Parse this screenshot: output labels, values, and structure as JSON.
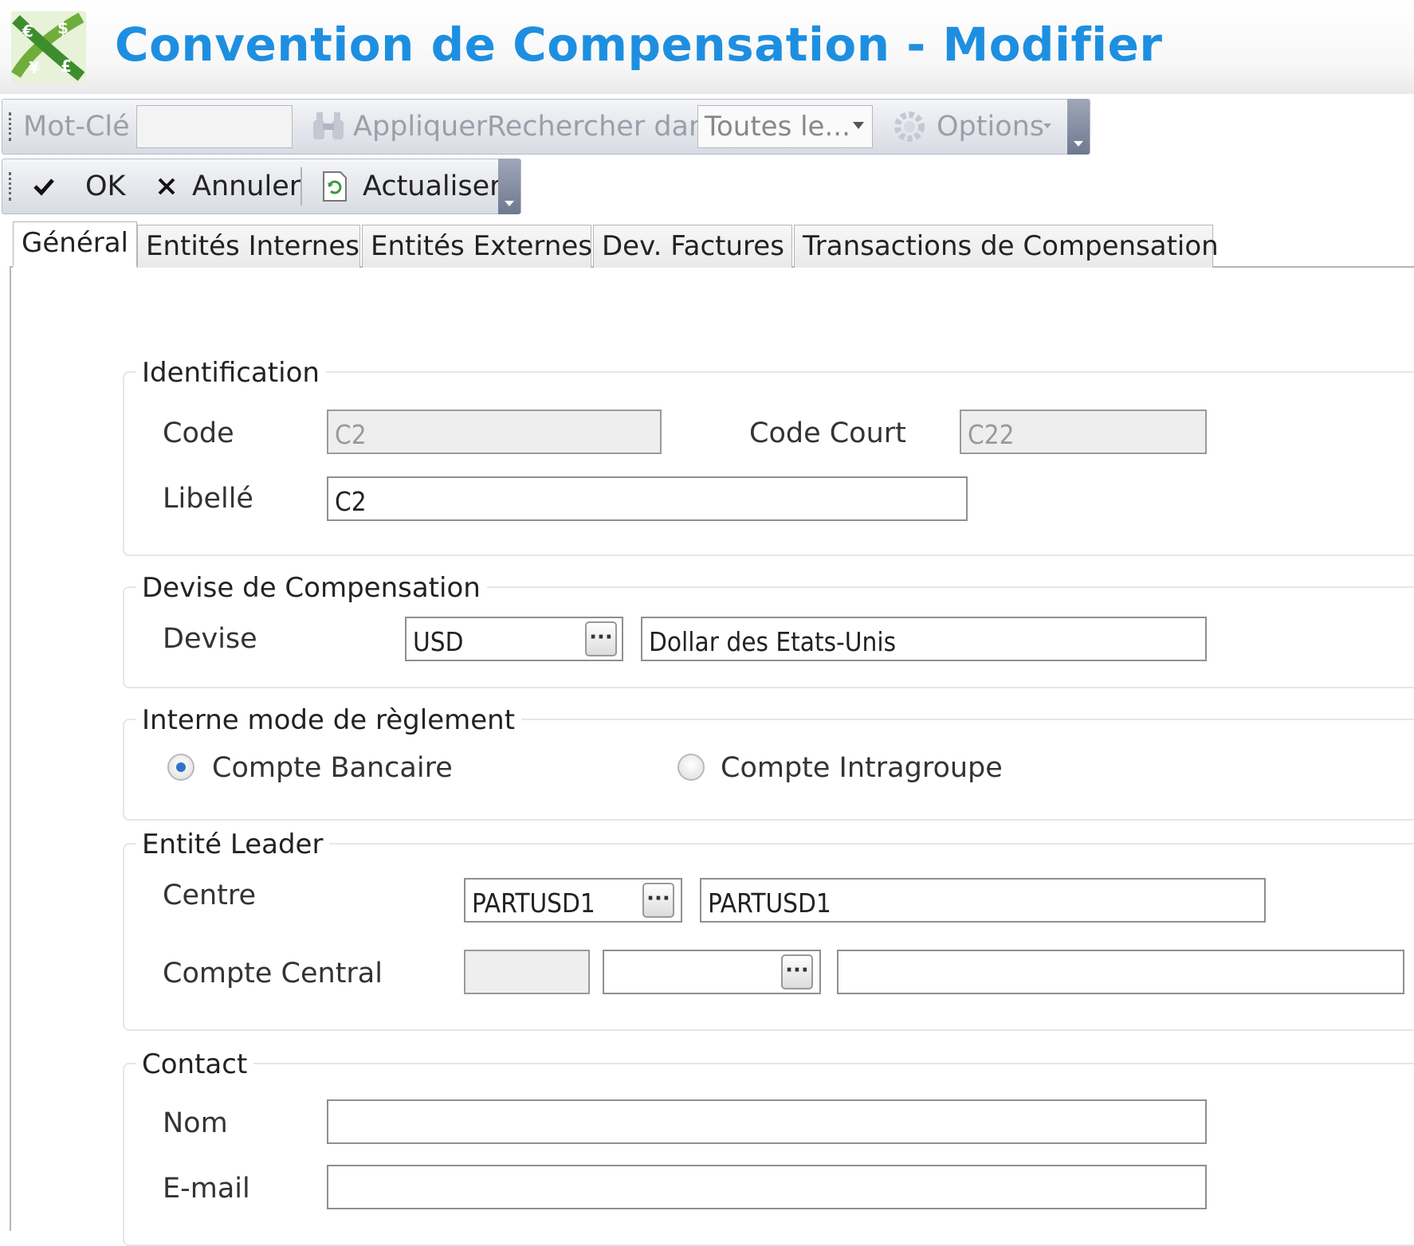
{
  "window": {
    "title": "Convention de Compensation - Modifier",
    "logo_icon": "currency-exchange-icon"
  },
  "search_toolbar": {
    "keyword_label": "Mot-Clé",
    "keyword_value": "",
    "apply_label": "Appliquer",
    "search_in_label": "Rechercher dans",
    "search_in_value": "Toutes le...",
    "options_label": "Options"
  },
  "action_toolbar": {
    "ok_label": "OK",
    "cancel_label": "Annuler",
    "refresh_label": "Actualiser"
  },
  "tabs": [
    {
      "label": "Général",
      "active": true
    },
    {
      "label": "Entités Internes"
    },
    {
      "label": "Entités Externes"
    },
    {
      "label": "Dev. Factures"
    },
    {
      "label": "Transactions de Compensation"
    }
  ],
  "identification": {
    "title": "Identification",
    "code_label": "Code",
    "code_value": "C2",
    "short_code_label": "Code Court",
    "short_code_value": "C22",
    "label_label": "Libellé",
    "label_value": "C2"
  },
  "currency": {
    "title": "Devise de Compensation",
    "currency_label": "Devise",
    "currency_code": "USD",
    "currency_name": "Dollar des Etats-Unis"
  },
  "settlement": {
    "title": "Interne mode de règlement",
    "options": [
      {
        "label": "Compte Bancaire",
        "checked": true
      },
      {
        "label": "Compte Intragroupe",
        "checked": false
      }
    ]
  },
  "leader": {
    "title": "Entité Leader",
    "centre_label": "Centre",
    "centre_code": "PARTUSD1",
    "centre_name": "PARTUSD1",
    "central_account_label": "Compte Central",
    "central_account_prefix": "",
    "central_account_code": "",
    "central_account_name": ""
  },
  "contact": {
    "title": "Contact",
    "name_label": "Nom",
    "name_value": "",
    "email_label": "E-mail",
    "email_value": ""
  },
  "colors": {
    "title": "#1e8fe0",
    "radio_selected": "#2f72c8"
  }
}
